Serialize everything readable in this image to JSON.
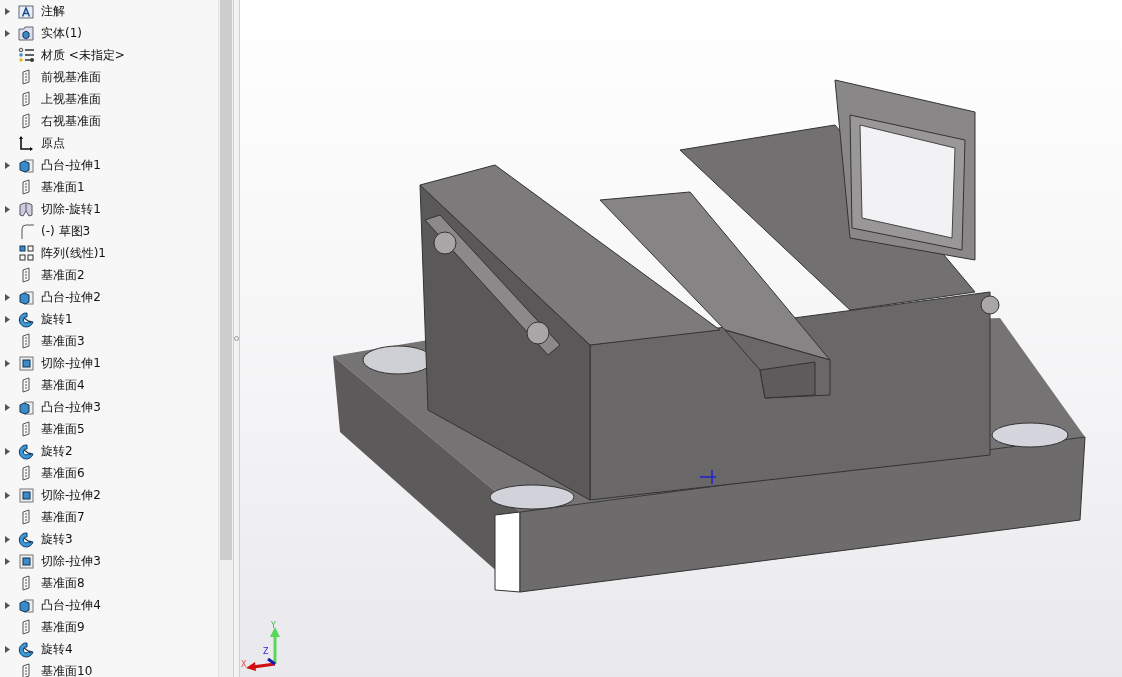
{
  "feature_tree": [
    {
      "label": "注解",
      "kind": "annotation",
      "expandable": true
    },
    {
      "label": "实体(1)",
      "kind": "body",
      "expandable": true
    },
    {
      "label": "材质 <未指定>",
      "kind": "material",
      "expandable": false
    },
    {
      "label": "前视基准面",
      "kind": "plane",
      "expandable": false
    },
    {
      "label": "上视基准面",
      "kind": "plane",
      "expandable": false
    },
    {
      "label": "右视基准面",
      "kind": "plane",
      "expandable": false
    },
    {
      "label": "原点",
      "kind": "origin",
      "expandable": false
    },
    {
      "label": "凸台-拉伸1",
      "kind": "boss",
      "expandable": true
    },
    {
      "label": "基准面1",
      "kind": "plane",
      "expandable": false
    },
    {
      "label": "切除-旋转1",
      "kind": "cut_revolve",
      "expandable": true
    },
    {
      "label": "(-) 草图3",
      "kind": "sketch",
      "expandable": false
    },
    {
      "label": "阵列(线性)1",
      "kind": "pattern",
      "expandable": false
    },
    {
      "label": "基准面2",
      "kind": "plane",
      "expandable": false
    },
    {
      "label": "凸台-拉伸2",
      "kind": "boss",
      "expandable": true
    },
    {
      "label": "旋转1",
      "kind": "revolve",
      "expandable": true
    },
    {
      "label": "基准面3",
      "kind": "plane",
      "expandable": false
    },
    {
      "label": "切除-拉伸1",
      "kind": "cut_extrude",
      "expandable": true
    },
    {
      "label": "基准面4",
      "kind": "plane",
      "expandable": false
    },
    {
      "label": "凸台-拉伸3",
      "kind": "boss",
      "expandable": true
    },
    {
      "label": "基准面5",
      "kind": "plane",
      "expandable": false
    },
    {
      "label": "旋转2",
      "kind": "revolve",
      "expandable": true
    },
    {
      "label": "基准面6",
      "kind": "plane",
      "expandable": false
    },
    {
      "label": "切除-拉伸2",
      "kind": "cut_extrude",
      "expandable": true
    },
    {
      "label": "基准面7",
      "kind": "plane",
      "expandable": false
    },
    {
      "label": "旋转3",
      "kind": "revolve",
      "expandable": true
    },
    {
      "label": "切除-拉伸3",
      "kind": "cut_extrude",
      "expandable": true
    },
    {
      "label": "基准面8",
      "kind": "plane",
      "expandable": false
    },
    {
      "label": "凸台-拉伸4",
      "kind": "boss",
      "expandable": true
    },
    {
      "label": "基准面9",
      "kind": "plane",
      "expandable": false
    },
    {
      "label": "旋转4",
      "kind": "revolve",
      "expandable": true
    },
    {
      "label": "基准面10",
      "kind": "plane",
      "expandable": false
    }
  ],
  "triad": {
    "x_label": "X",
    "y_label": "Y",
    "z_label": "Z"
  }
}
